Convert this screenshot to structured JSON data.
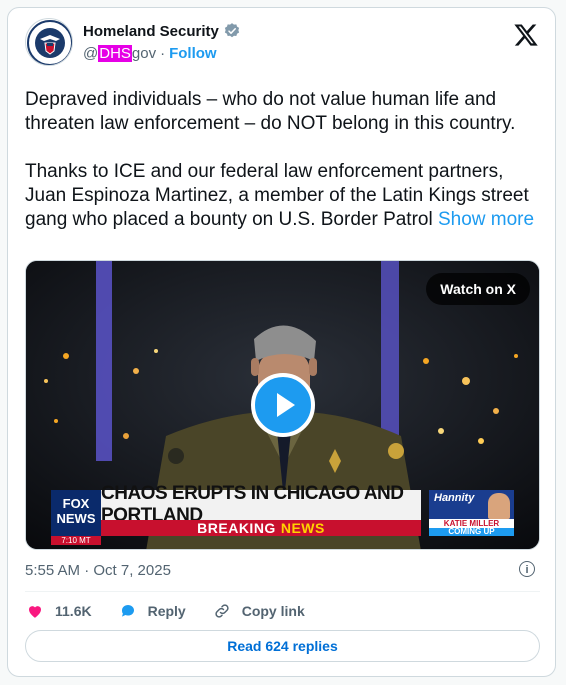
{
  "author": {
    "name": "Homeland Security",
    "handle_at": "@",
    "handle_highlight": "DHS",
    "handle_rest": "gov",
    "separator": "·",
    "follow_label": "Follow",
    "verified_icon": "verified-badge-icon",
    "avatar_icon": "dhs-seal-icon"
  },
  "post": {
    "paragraph1": "Depraved individuals – who do not value human life and threaten law enforcement – do NOT belong in this country.",
    "paragraph2": "Thanks to ICE and our federal law enforcement partners, Juan Espinoza Martinez, a member of the Latin Kings street gang who placed a bounty on U.S. Border Patrol",
    "show_more": "Show more"
  },
  "media": {
    "watch_label": "Watch on X",
    "chyron_headline": "CHAOS ERUPTS IN CHICAGO AND PORTLAND",
    "chyron_breaking": "BREAKING",
    "chyron_news": "NEWS",
    "network_line1": "FOX",
    "network_line2": "NEWS",
    "network_time": "7:10 MT",
    "promo_show": "Hannity",
    "promo_guest": "KATIE MILLER",
    "promo_status": "COMING UP"
  },
  "meta": {
    "timestamp": "5:55 AM · Oct 7, 2025"
  },
  "actions": {
    "likes": "11.6K",
    "reply_label": "Reply",
    "copy_label": "Copy link",
    "read_replies": "Read 624 replies"
  },
  "colors": {
    "link": "#1d9bf0",
    "like": "#f91880",
    "muted": "#536471",
    "text": "#0f1419",
    "highlight": "#e600e6"
  }
}
